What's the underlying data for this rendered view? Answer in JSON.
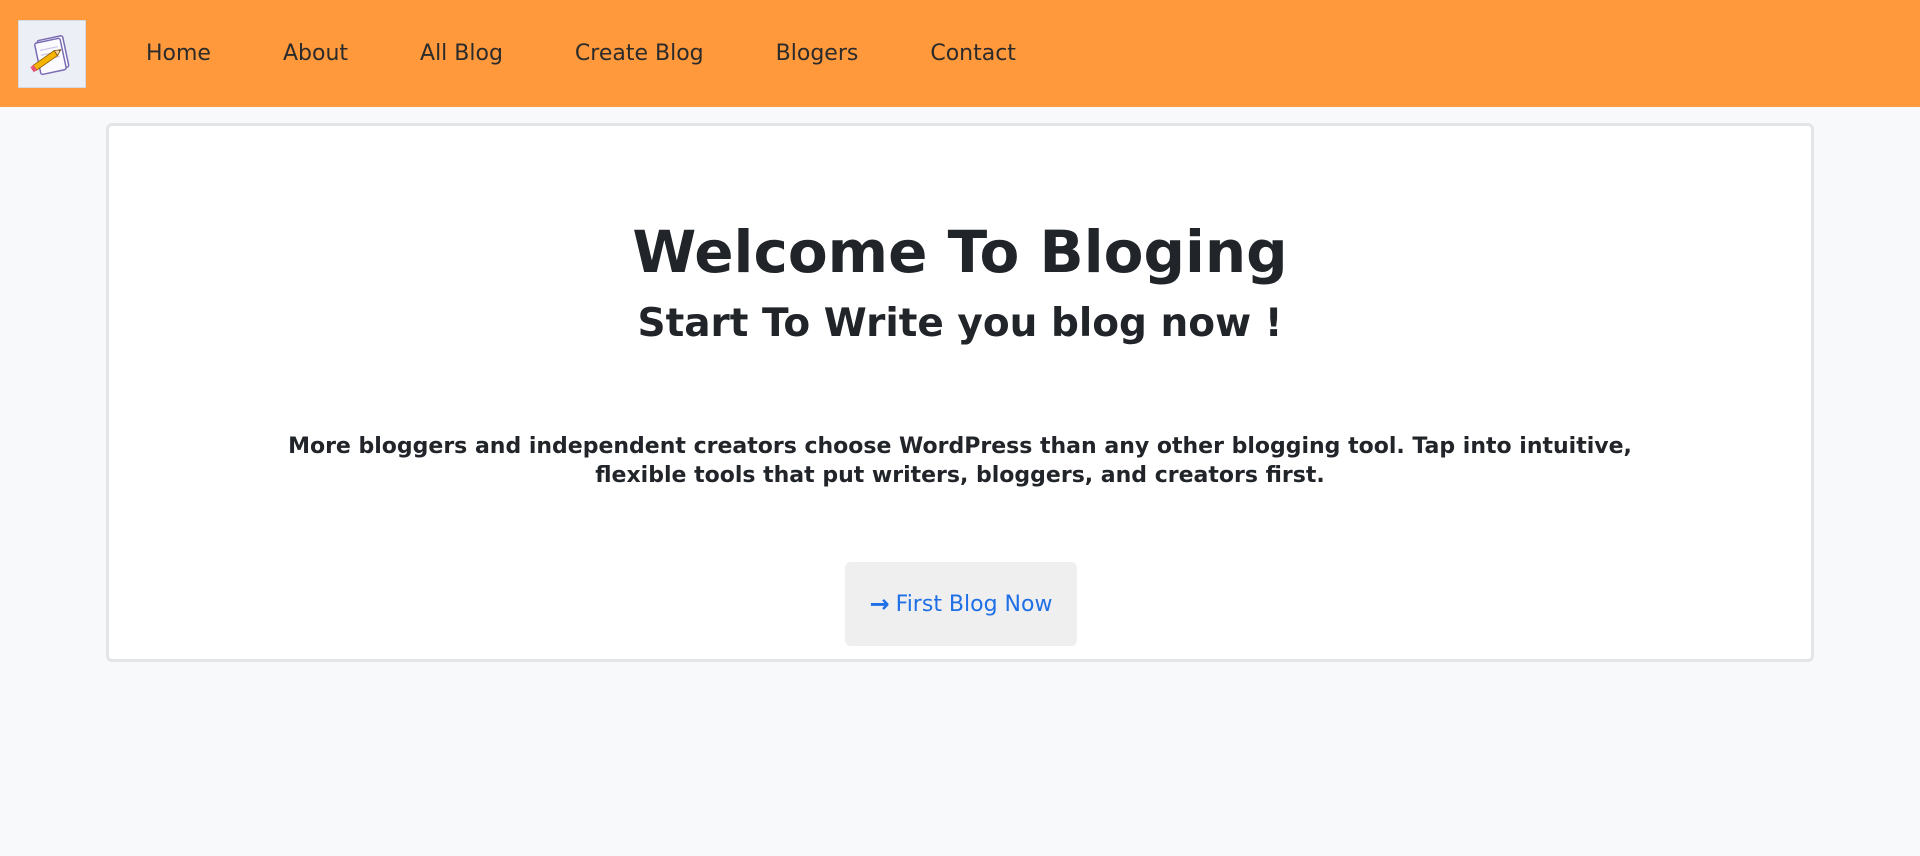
{
  "navbar": {
    "logo_icon": "notepad-pencil-icon",
    "background": "#ff993b",
    "links": [
      {
        "label": "Home"
      },
      {
        "label": "About"
      },
      {
        "label": "All Blog"
      },
      {
        "label": "Create Blog"
      },
      {
        "label": "Blogers"
      },
      {
        "label": "Contact"
      }
    ]
  },
  "hero": {
    "title": "Welcome To Bloging",
    "subtitle": "Start To Write you blog now !",
    "description": "More bloggers and independent creators choose WordPress than any other blogging tool. Tap into intuitive, flexible tools that put writers, bloggers, and creators first.",
    "cta": {
      "icon": "arrow-right-icon",
      "arrow": "→",
      "label": "First Blog Now",
      "color": "#1f6fe6"
    }
  }
}
